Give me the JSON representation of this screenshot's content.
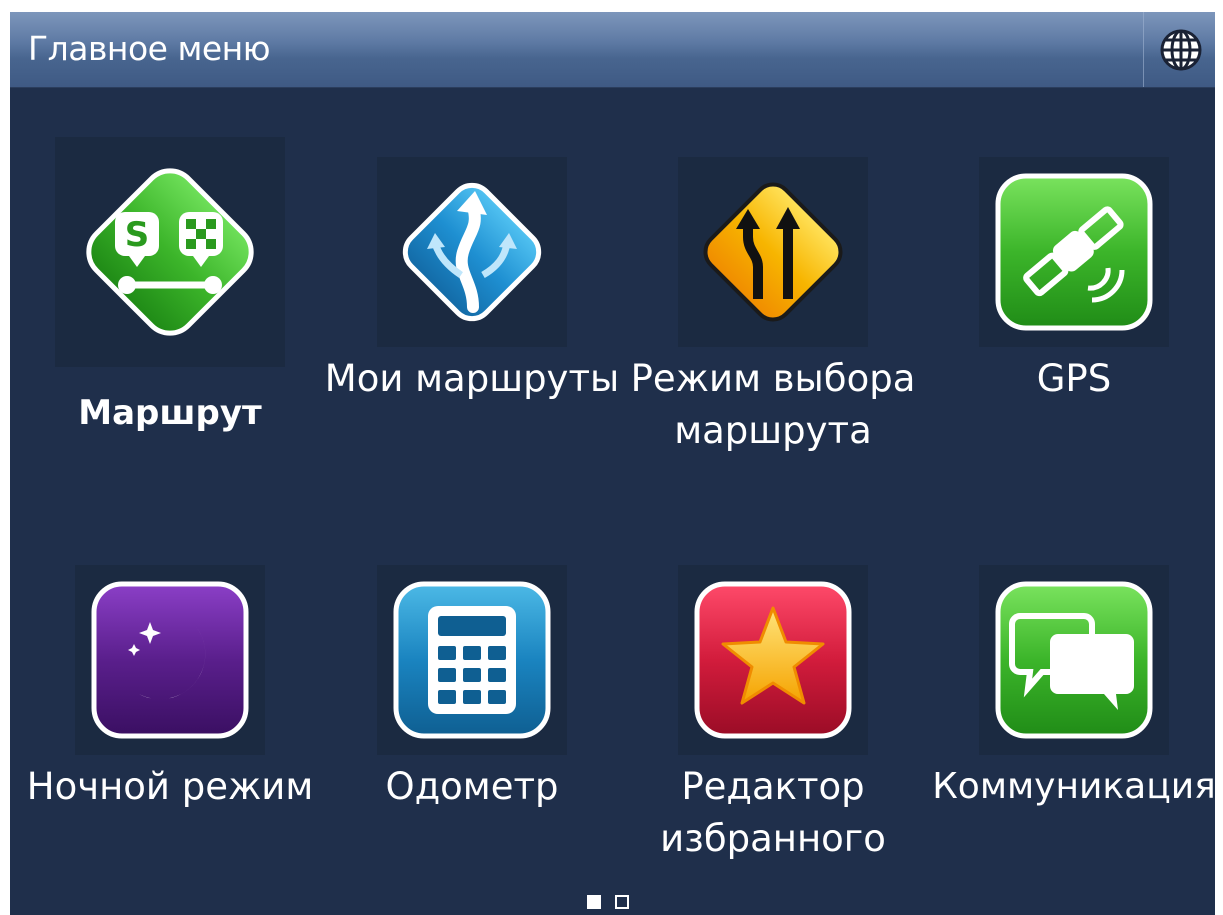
{
  "header": {
    "title": "Главное меню",
    "globe_icon": "globe-icon"
  },
  "menu": {
    "items": [
      {
        "label": "Маршрут",
        "icon": "route-icon",
        "selected": true
      },
      {
        "label": "Мои маршруты",
        "icon": "my-routes-icon",
        "selected": false
      },
      {
        "label": "Режим выбора маршрута",
        "icon": "route-mode-icon",
        "selected": false
      },
      {
        "label": "GPS",
        "icon": "satellite-icon",
        "selected": false
      },
      {
        "label": "Ночной режим",
        "icon": "night-mode-icon",
        "selected": false
      },
      {
        "label": "Одометр",
        "icon": "calculator-icon",
        "selected": false
      },
      {
        "label": "Редактор избранного",
        "icon": "star-icon",
        "selected": false
      },
      {
        "label": "Коммуникация",
        "icon": "chat-bubbles-icon",
        "selected": false
      }
    ]
  },
  "pager": {
    "current_page": 1,
    "total_pages": 2
  },
  "colors": {
    "background": "#1f2f4b",
    "titlebar": "#5e7aa4",
    "green": "#3cb52a",
    "blue": "#1e8fd1",
    "yellow": "#f7b500",
    "purple": "#5a1f8c",
    "red": "#d21c3c"
  }
}
